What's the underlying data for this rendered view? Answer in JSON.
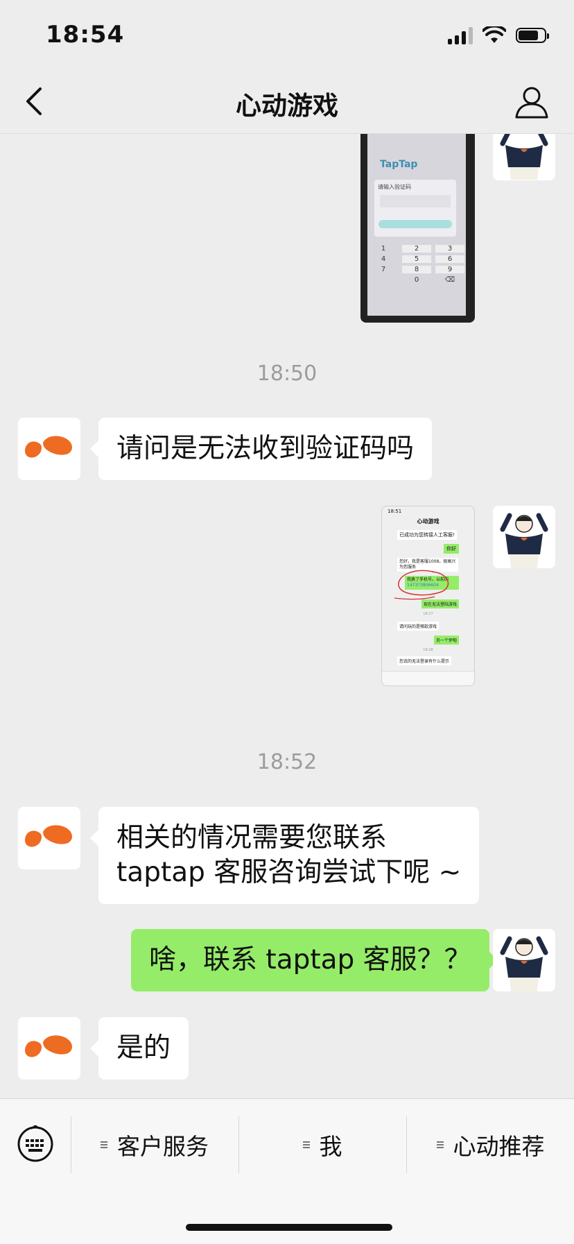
{
  "status_bar": {
    "time": "18:54"
  },
  "nav": {
    "title": "心动游戏"
  },
  "chat": {
    "timestamp_1": "18:50",
    "timestamp_2": "18:52",
    "messages": [
      {
        "from": "agent",
        "text": "请问是无法收到验证码吗"
      },
      {
        "from": "agent",
        "text_line1": "相关的情况需要您联系",
        "text_line2": "taptap 客服咨询尝试下呢 ~"
      },
      {
        "from": "user",
        "text": "啥，联系 taptap 客服？？"
      },
      {
        "from": "agent",
        "text": "是的"
      }
    ],
    "photo_1": {
      "app_logo": "TapTap",
      "dialog_title": "请输入验证码",
      "keypad": [
        "1",
        "2",
        "3",
        "4",
        "5",
        "6",
        "7",
        "8",
        "9",
        "0"
      ]
    },
    "photo_2": {
      "time": "18:51",
      "title": "心动游戏",
      "lines": [
        "已成功为您转接人工客服!",
        "你好",
        "您好，我是客服1008，很高兴为您服务",
        "我换了手机号，以前的",
        "147373806604",
        "现在无法登陆游戏",
        "18:27",
        "请问玩的是哪款游戏",
        "另一个伊甸",
        "18:28",
        "您说的无法登录有什么提示"
      ]
    }
  },
  "bottom_menu": {
    "items": [
      "客户服务",
      "我",
      "心动推荐"
    ]
  },
  "colors": {
    "user_bubble": "#95ec69",
    "agent_bubble": "#ffffff",
    "brand_orange": "#ee6b22",
    "background": "#ededed"
  }
}
